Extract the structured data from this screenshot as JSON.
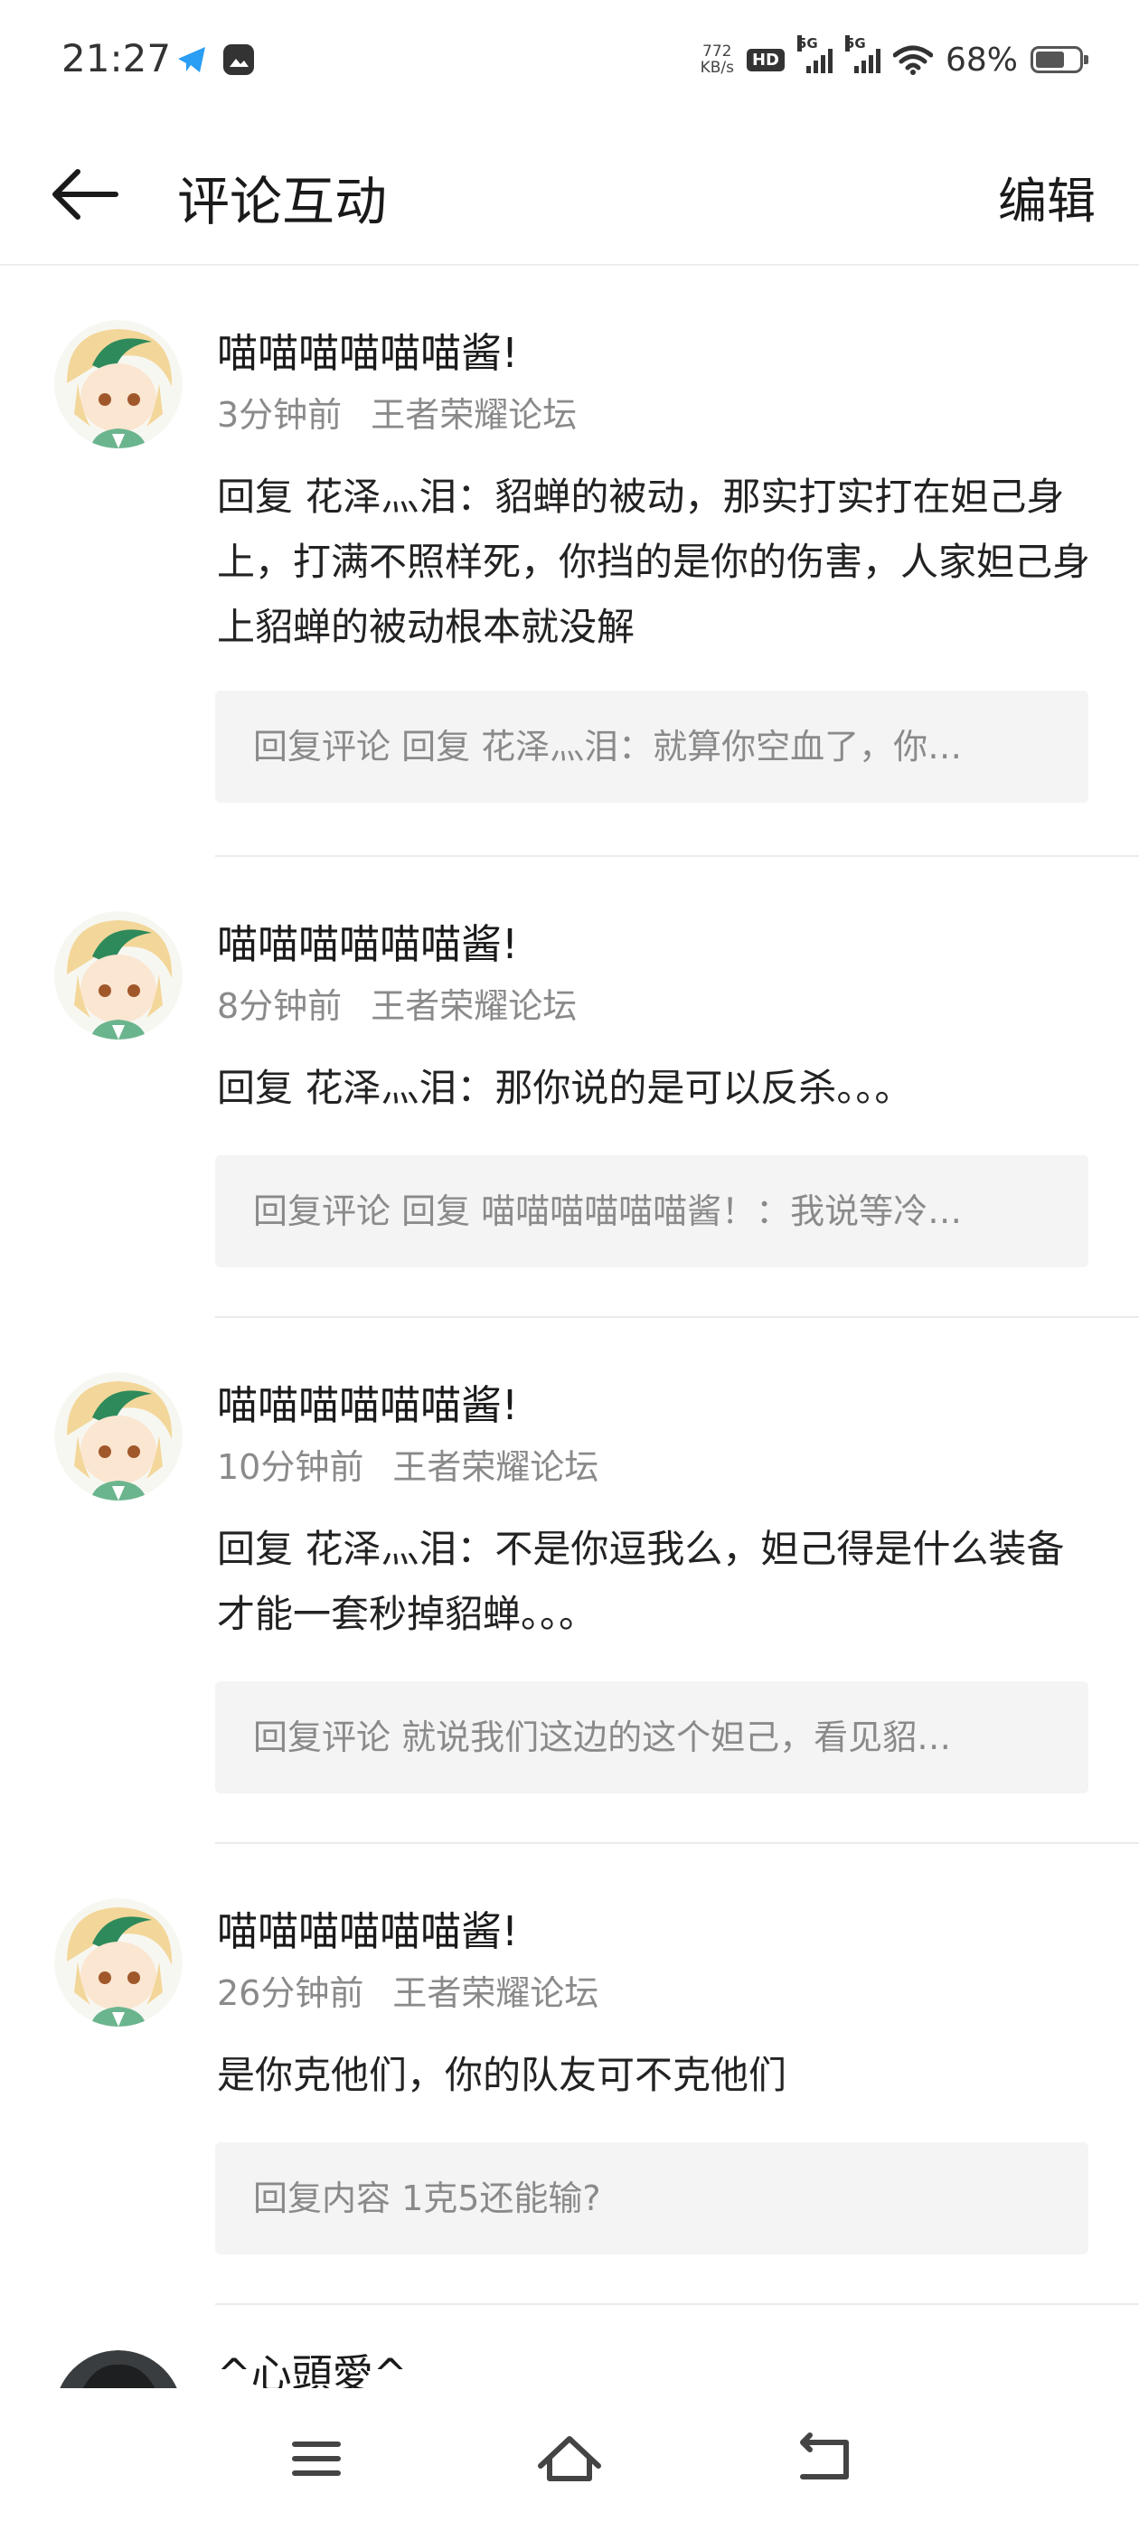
{
  "status_bar": {
    "time": "21:27",
    "net_speed_value": "772",
    "net_speed_unit": "KB/s",
    "hd_label": "HD",
    "signal_label": "5G",
    "battery_percent": "68%",
    "battery_level": 0.68
  },
  "header": {
    "title": "评论互动",
    "edit_label": "编辑"
  },
  "comments": [
    {
      "username": "喵喵喵喵喵喵酱!",
      "time": "3分钟前",
      "forum": "王者荣耀论坛",
      "content": "回复 花泽灬泪：貂蝉的被动，那实打实打在妲己身上，打满不照样死，你挡的是你的伤害，人家妲己身上貂蝉的被动根本就没解",
      "quote": "回复评论 回复 花泽灬泪：就算你空血了，你…"
    },
    {
      "username": "喵喵喵喵喵喵酱!",
      "time": "8分钟前",
      "forum": "王者荣耀论坛",
      "content": "回复 花泽灬泪：那你说的是可以反杀。。。",
      "quote": "回复评论 回复 喵喵喵喵喵喵酱！：我说等冷…"
    },
    {
      "username": "喵喵喵喵喵喵酱!",
      "time": "10分钟前",
      "forum": "王者荣耀论坛",
      "content": "回复 花泽灬泪：不是你逗我么，妲己得是什么装备才能一套秒掉貂蝉。。。",
      "quote": "回复评论 就说我们这边的这个妲己，看见貂…"
    },
    {
      "username": "喵喵喵喵喵喵酱!",
      "time": "26分钟前",
      "forum": "王者荣耀论坛",
      "content": "是你克他们，你的队友可不克他们",
      "quote": "回复内容 1克5还能输?"
    },
    {
      "username": "^心頭愛^"
    }
  ],
  "icons": {
    "back": "arrow-left-icon",
    "menu": "menu-icon",
    "home": "home-icon",
    "return": "return-icon"
  },
  "colors": {
    "meta_text": "#8a8a8a",
    "quote_bg": "#f4f4f4",
    "avatar_hair": "#f3d79a",
    "avatar_accent": "#2f8a5b"
  }
}
